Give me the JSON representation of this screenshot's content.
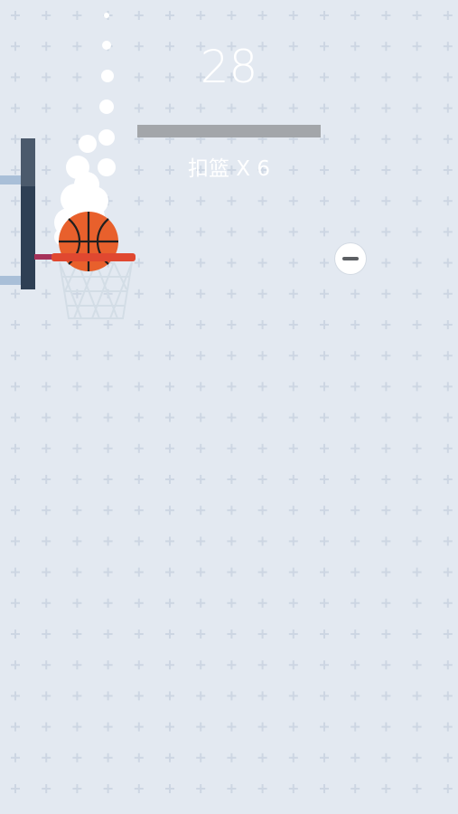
{
  "hud": {
    "score": "28",
    "combo_text": "扣篮 X 6",
    "progress": 1.0
  },
  "controls": {
    "minus_button_icon": "minus-icon"
  },
  "colors": {
    "background": "#e3e9f1",
    "grid_plus": "#cdd6e3",
    "backboard": "#2e3f54",
    "ball": "#e8602c",
    "rim": "#e04830",
    "net": "#d3dde6",
    "progress_bar": "#a3a6aa"
  },
  "icons": [
    "basketball-icon",
    "hoop-icon",
    "minus-icon"
  ]
}
